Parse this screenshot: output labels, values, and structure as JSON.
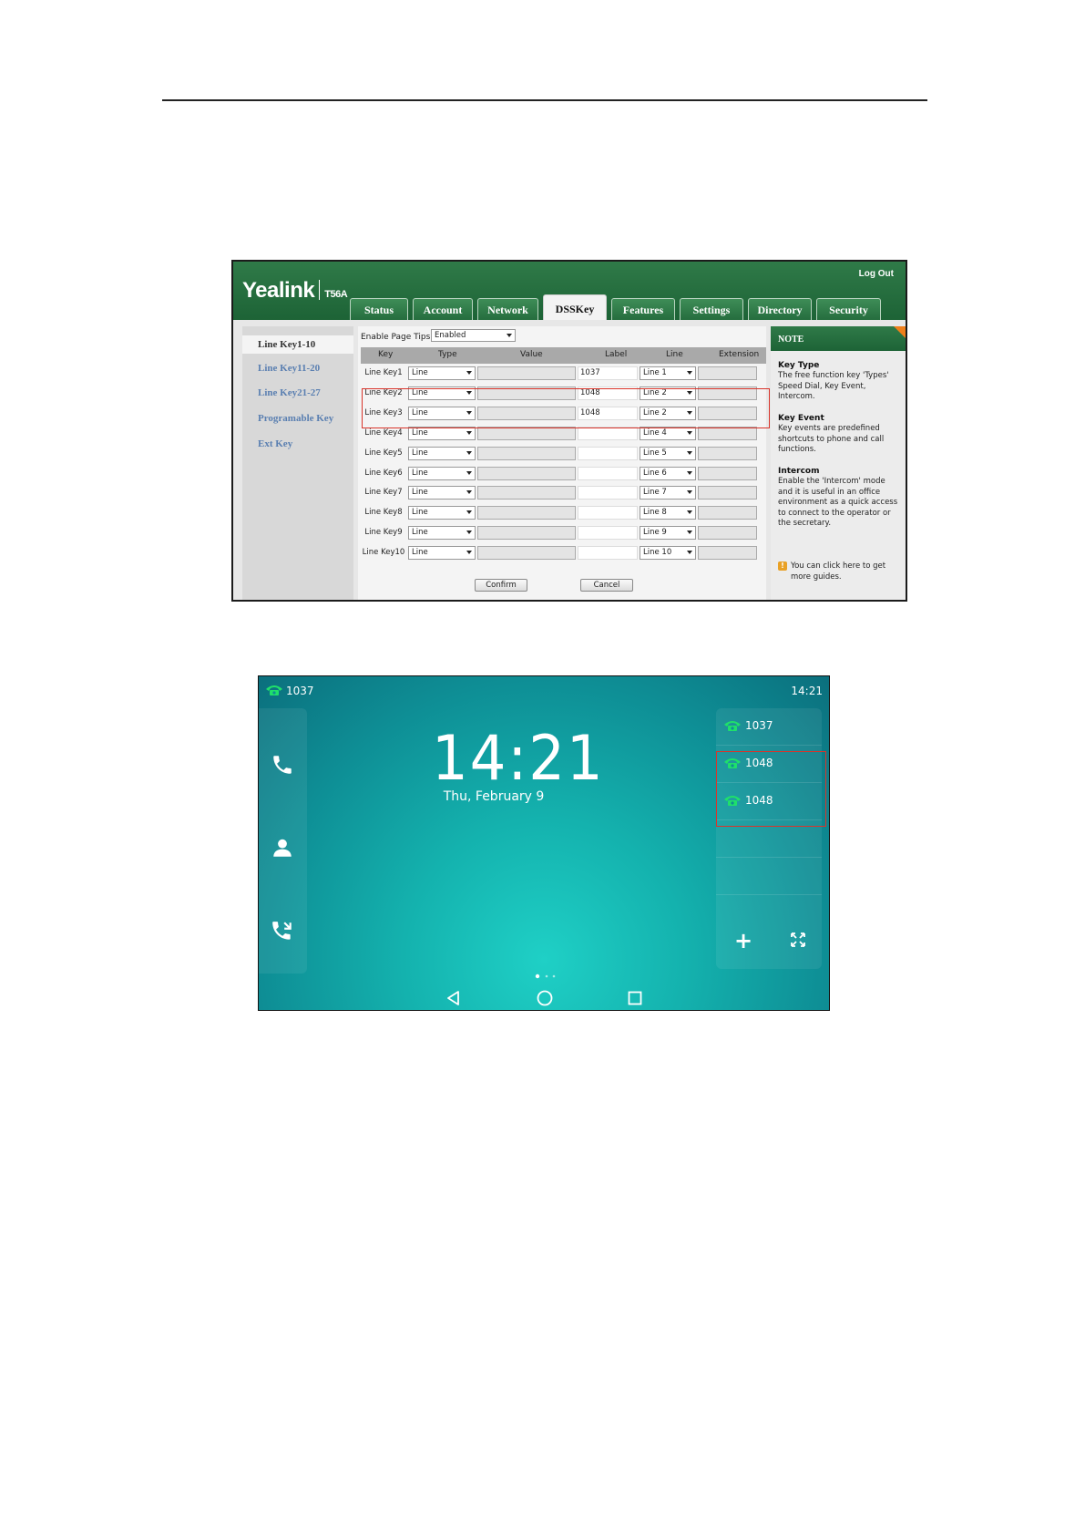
{
  "web": {
    "logo": "Yealink",
    "model": "T56A",
    "logout": "Log Out",
    "tabs": [
      "Status",
      "Account",
      "Network",
      "DSSKey",
      "Features",
      "Settings",
      "Directory",
      "Security"
    ],
    "active_tab": "DSSKey",
    "sidebar": [
      "Line Key1-10",
      "Line Key11-20",
      "Line Key21-27",
      "Programable Key",
      "Ext Key"
    ],
    "page_tips_label": "Enable Page Tips",
    "page_tips_value": "Enabled",
    "columns": [
      "Key",
      "Type",
      "Value",
      "Label",
      "Line",
      "Extension"
    ],
    "rows": [
      {
        "key": "Line Key1",
        "type": "Line",
        "label": "1037",
        "line": "Line 1"
      },
      {
        "key": "Line Key2",
        "type": "Line",
        "label": "1048",
        "line": "Line 2"
      },
      {
        "key": "Line Key3",
        "type": "Line",
        "label": "1048",
        "line": "Line 2"
      },
      {
        "key": "Line Key4",
        "type": "Line",
        "label": "",
        "line": "Line 4"
      },
      {
        "key": "Line Key5",
        "type": "Line",
        "label": "",
        "line": "Line 5"
      },
      {
        "key": "Line Key6",
        "type": "Line",
        "label": "",
        "line": "Line 6"
      },
      {
        "key": "Line Key7",
        "type": "Line",
        "label": "",
        "line": "Line 7"
      },
      {
        "key": "Line Key8",
        "type": "Line",
        "label": "",
        "line": "Line 8"
      },
      {
        "key": "Line Key9",
        "type": "Line",
        "label": "",
        "line": "Line 9"
      },
      {
        "key": "Line Key10",
        "type": "Line",
        "label": "",
        "line": "Line 10"
      }
    ],
    "confirm": "Confirm",
    "cancel": "Cancel",
    "note": {
      "header": "NOTE",
      "sections": [
        {
          "title": "Key Type",
          "text": "The free function key 'Types' Speed Dial, Key Event, Intercom."
        },
        {
          "title": "Key Event",
          "text": "Key events are predefined shortcuts to phone and call functions."
        },
        {
          "title": "Intercom",
          "text": "Enable the 'Intercom' mode and it is useful in an office environment as a quick access to connect to the operator or the secretary."
        }
      ],
      "guide": "You can click here to get more guides."
    }
  },
  "phone": {
    "status_account": "1037",
    "status_time": "14:21",
    "clock": "14:21",
    "date": "Thu, February 9",
    "line_keys": [
      "1037",
      "1048",
      "1048"
    ],
    "plus": "+",
    "line_icon_color": "#1fe06a"
  }
}
